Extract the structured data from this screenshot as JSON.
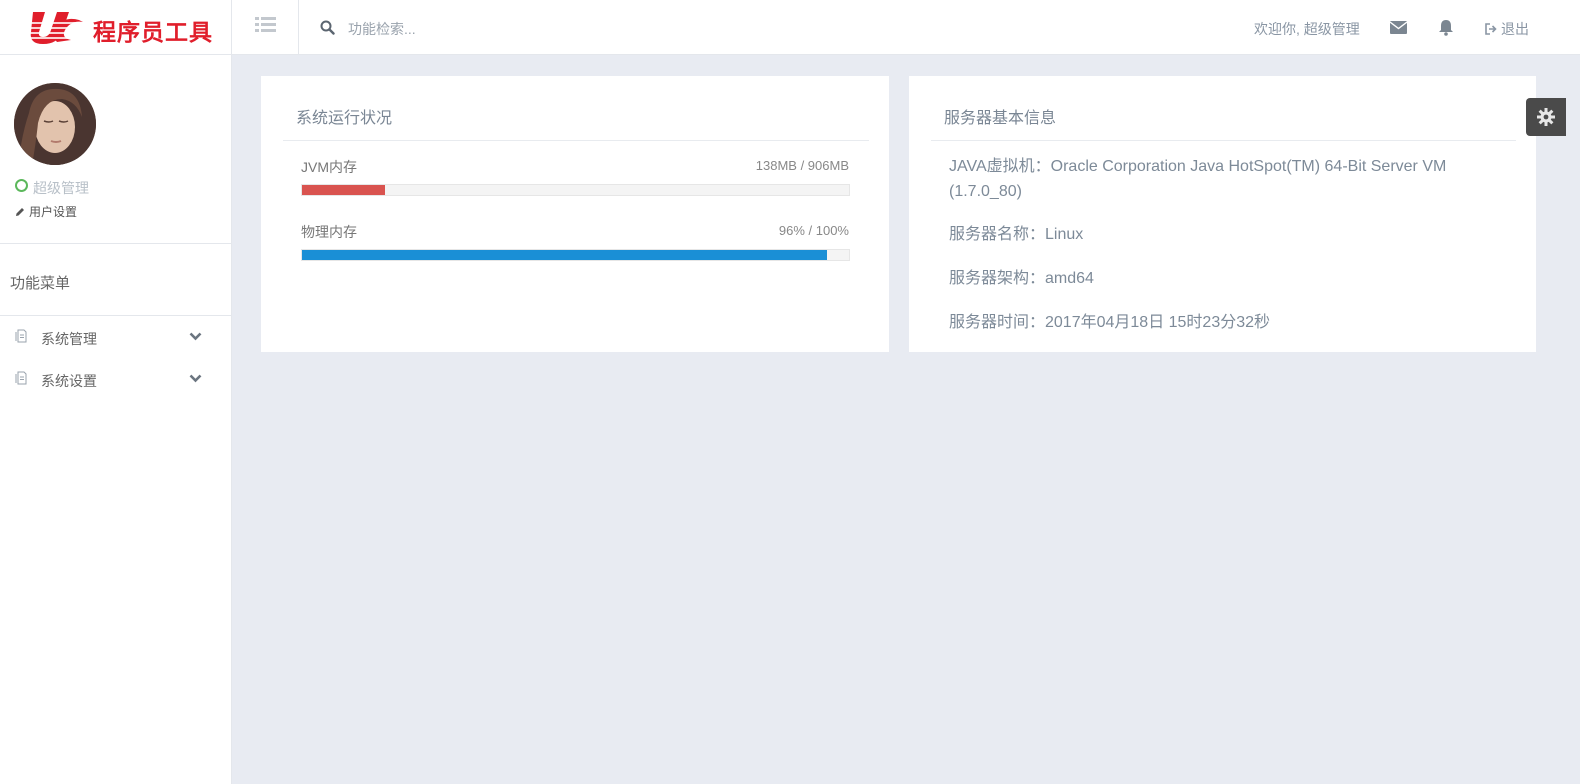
{
  "brand": {
    "name": "程序员工具",
    "colors": {
      "brand_red": "#e01e2b",
      "jvm_bar": "#d9534f",
      "physical_bar": "#1a8fd6",
      "online": "#5cb85c"
    }
  },
  "topbar": {
    "search_placeholder": "功能检索...",
    "welcome_text": "欢迎你, 超级管理",
    "logout_label": "退出",
    "icons": [
      "list-icon",
      "search-icon",
      "mail-icon",
      "bell-icon",
      "sign-out-icon"
    ]
  },
  "sidebar": {
    "role": "超级管理",
    "user_settings_label": "用户设置",
    "menu_title": "功能菜单",
    "items": [
      {
        "label": "系统管理",
        "icon": "file-icon"
      },
      {
        "label": "系统设置",
        "icon": "file-icon"
      }
    ]
  },
  "system_status": {
    "title": "系统运行状况",
    "jvm": {
      "label": "JVM内存",
      "value_text": "138MB / 906MB",
      "used": 138,
      "total": 906
    },
    "physical": {
      "label": "物理内存",
      "value_text": "96% / 100%",
      "percent": 96
    }
  },
  "server_info": {
    "title": "服务器基本信息",
    "java_vm": "JAVA虚拟机：Oracle Corporation Java HotSpot(TM) 64-Bit Server VM (1.7.0_80)",
    "server_name": "服务器名称：Linux",
    "server_arch": "服务器架构：amd64",
    "server_time": "服务器时间：2017年04月18日 15时23分32秒"
  }
}
